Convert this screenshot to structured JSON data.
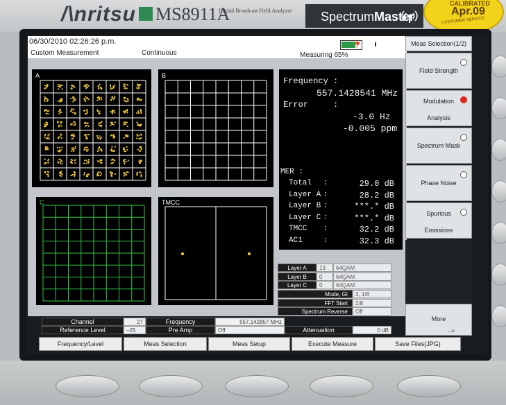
{
  "device": {
    "brand": "/\\nritsu",
    "model": "MS8911A",
    "description": "Digital Broadcast Field Analyzer",
    "product_name_prefix": "Spectrum",
    "product_name_suffix": "Master",
    "calibration_top": "CALIBRATED",
    "calibration_date": "Apr.09",
    "calibration_bottom": "CUSTOMER SERVICE"
  },
  "status": {
    "datetime": "06/30/2010 02:26:26 p.m.",
    "mode": "Custom Measurement",
    "sweep": "Continuous",
    "measuring": "Measuring  65%"
  },
  "panels": {
    "a_label": "A",
    "b_label": "B",
    "c_label": "C",
    "tmcc_label": "TMCC"
  },
  "readout": {
    "frequency_label": "Frequency :",
    "frequency_value": "557.1428541 MHz",
    "error_label": "Error     :",
    "error_hz": "-3.0 Hz",
    "error_ppm": "-0.005 ppm",
    "mer_label": "MER :",
    "mer_rows": [
      {
        "label": "Total",
        "sep": ":",
        "value": "29.0 dB"
      },
      {
        "label": "Layer A",
        "sep": ":",
        "value": "28.2 dB"
      },
      {
        "label": "Layer B",
        "sep": ":",
        "value": "***.* dB"
      },
      {
        "label": "Layer C",
        "sep": ":",
        "value": "***.* dB"
      },
      {
        "label": "TMCC",
        "sep": ":",
        "value": "32.2 dB"
      },
      {
        "label": "AC1",
        "sep": ":",
        "value": "32.3 dB"
      }
    ]
  },
  "layers": [
    {
      "name": "Layer A",
      "segments": "13",
      "modulation": "64QAM"
    },
    {
      "name": "Layer B",
      "segments": "0",
      "modulation": "64QAM"
    },
    {
      "name": "Layer C",
      "segments": "0",
      "modulation": "64QAM"
    }
  ],
  "params": [
    {
      "label": "Mode, GI",
      "value": "3, 1/8"
    },
    {
      "label": "FFT Start",
      "value": "2/8"
    },
    {
      "label": "Spectrum Reverse",
      "value": "Off"
    }
  ],
  "bottom_params": {
    "channel_label": "Channel",
    "channel_value": "27",
    "frequency_label": "Frequency",
    "frequency_value": "557.142857 MHz",
    "ref_level_label": "Reference Level",
    "ref_level_value": "−25 dBm",
    "preamp_label": "Pre Amp",
    "preamp_value": "Off",
    "attenuation_label": "Attenuation",
    "attenuation_value": "0 dB"
  },
  "softkeys": {
    "menu_title": "Meas Selection(1/2)",
    "items": [
      {
        "line1": "Field Strength",
        "line2": ""
      },
      {
        "line1": "Modulation",
        "line2": "Analysis"
      },
      {
        "line1": "Spectrum Mask",
        "line2": ""
      },
      {
        "line1": "Phase Noise",
        "line2": ""
      },
      {
        "line1": "Spurious",
        "line2": "Emissions"
      }
    ],
    "more": "More",
    "more_arrow": "-->"
  },
  "bottom_keys": [
    "Frequency/Level",
    "Meas Selection",
    "Meas Setup",
    "Execute Measure",
    "Save Files(JPG)"
  ],
  "colors": {
    "constellation_grid": "#ffffff",
    "constellation_points": "#e8c23a",
    "panel_c_grid": "#35c84a",
    "active_indicator": "#e0281e"
  },
  "icons": {
    "signal": "antenna-signal-icon",
    "battery": "battery-icon"
  }
}
